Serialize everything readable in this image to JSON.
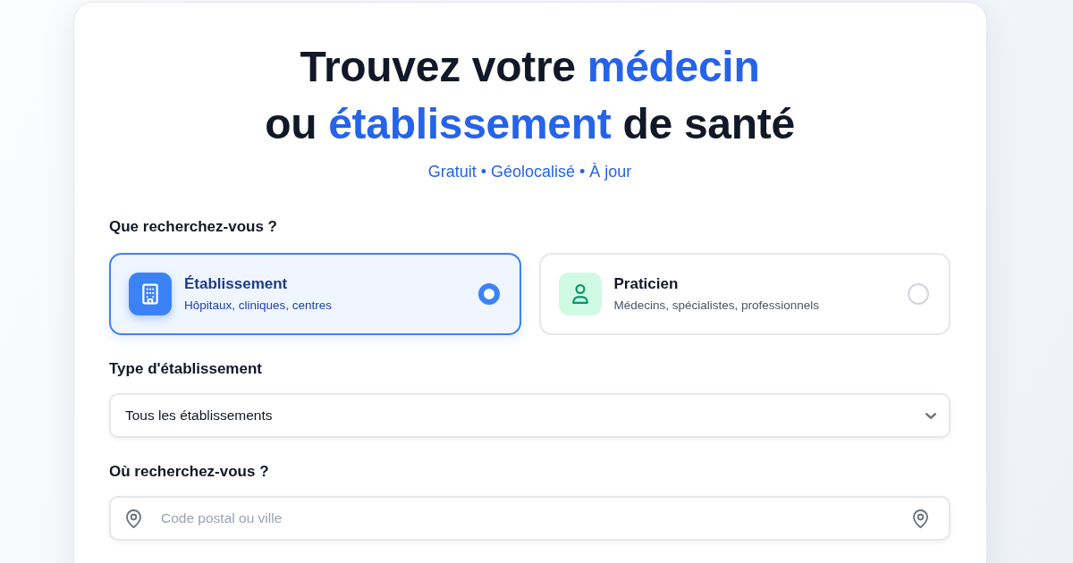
{
  "heading": {
    "lines": [
      [
        {
          "text": "Trouvez votre ",
          "highlight": false
        },
        {
          "text": "médecin",
          "highlight": true
        }
      ],
      [
        {
          "text": "ou ",
          "highlight": false
        },
        {
          "text": "établissement",
          "highlight": true
        },
        {
          "text": " de santé",
          "highlight": false
        }
      ]
    ],
    "subtitle": "Gratuit • Géolocalisé • À jour"
  },
  "search_type": {
    "label": "Que recherchez-vous ?",
    "options": [
      {
        "kind": "building",
        "title": "Établissement",
        "description": "Hôpitaux, cliniques, centres",
        "selected": true
      },
      {
        "kind": "person",
        "title": "Praticien",
        "description": "Médecins, spécialistes, professionnels",
        "selected": false
      }
    ]
  },
  "establishment_type": {
    "label": "Type d'établissement",
    "value": "Tous les établissements"
  },
  "location": {
    "label": "Où recherchez-vous ?",
    "placeholder": "Code postal ou ville"
  }
}
